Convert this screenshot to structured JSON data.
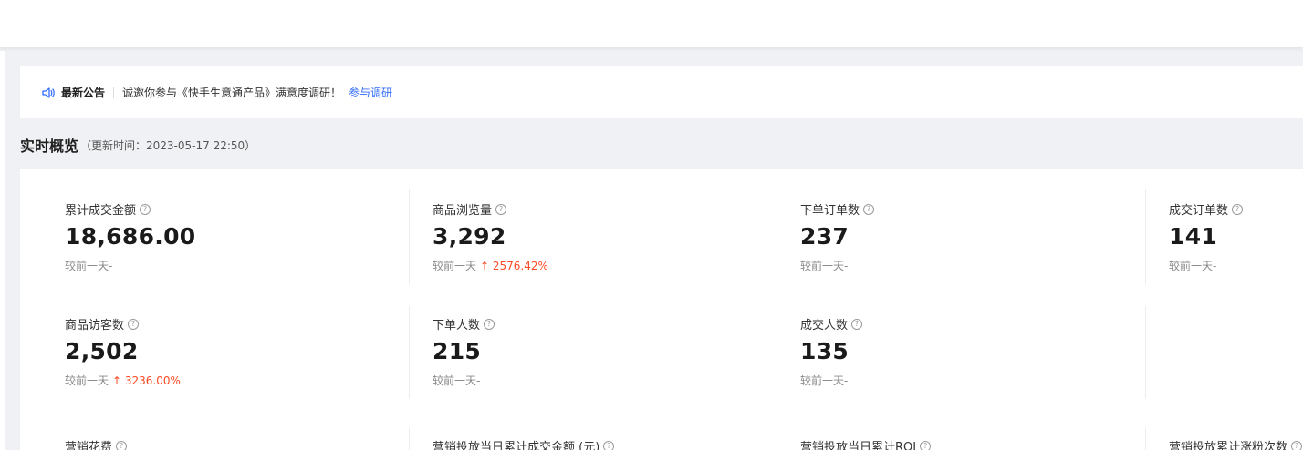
{
  "announcement": {
    "icon": "speaker-icon",
    "title": "最新公告",
    "text": "诚邀你参与《快手生意通产品》满意度调研！",
    "link": "参与调研"
  },
  "overview": {
    "title": "实时概览",
    "update_time": "（更新时间：2023-05-17 22:50）"
  },
  "metrics": [
    {
      "label": "累计成交金额",
      "value": "18,686.00",
      "compare_label": "较前一天",
      "change": "-",
      "trend": "none"
    },
    {
      "label": "商品浏览量",
      "value": "3,292",
      "compare_label": "较前一天",
      "change": "2576.42%",
      "trend": "up"
    },
    {
      "label": "下单订单数",
      "value": "237",
      "compare_label": "较前一天",
      "change": "-",
      "trend": "none"
    },
    {
      "label": "成交订单数",
      "value": "141",
      "compare_label": "较前一天",
      "change": "-",
      "trend": "none"
    },
    {
      "label": "商品访客数",
      "value": "2,502",
      "compare_label": "较前一天",
      "change": "3236.00%",
      "trend": "up"
    },
    {
      "label": "下单人数",
      "value": "215",
      "compare_label": "较前一天",
      "change": "-",
      "trend": "none"
    },
    {
      "label": "成交人数",
      "value": "135",
      "compare_label": "较前一天",
      "change": "-",
      "trend": "none"
    }
  ],
  "marketing_labels": [
    "营销花费",
    "营销投放当日累计成交金额 (元)",
    "营销投放当日累计ROI",
    "营销投放累计涨粉次数"
  ],
  "colors": {
    "accent": "#326bfb",
    "up": "#fe4a24"
  }
}
